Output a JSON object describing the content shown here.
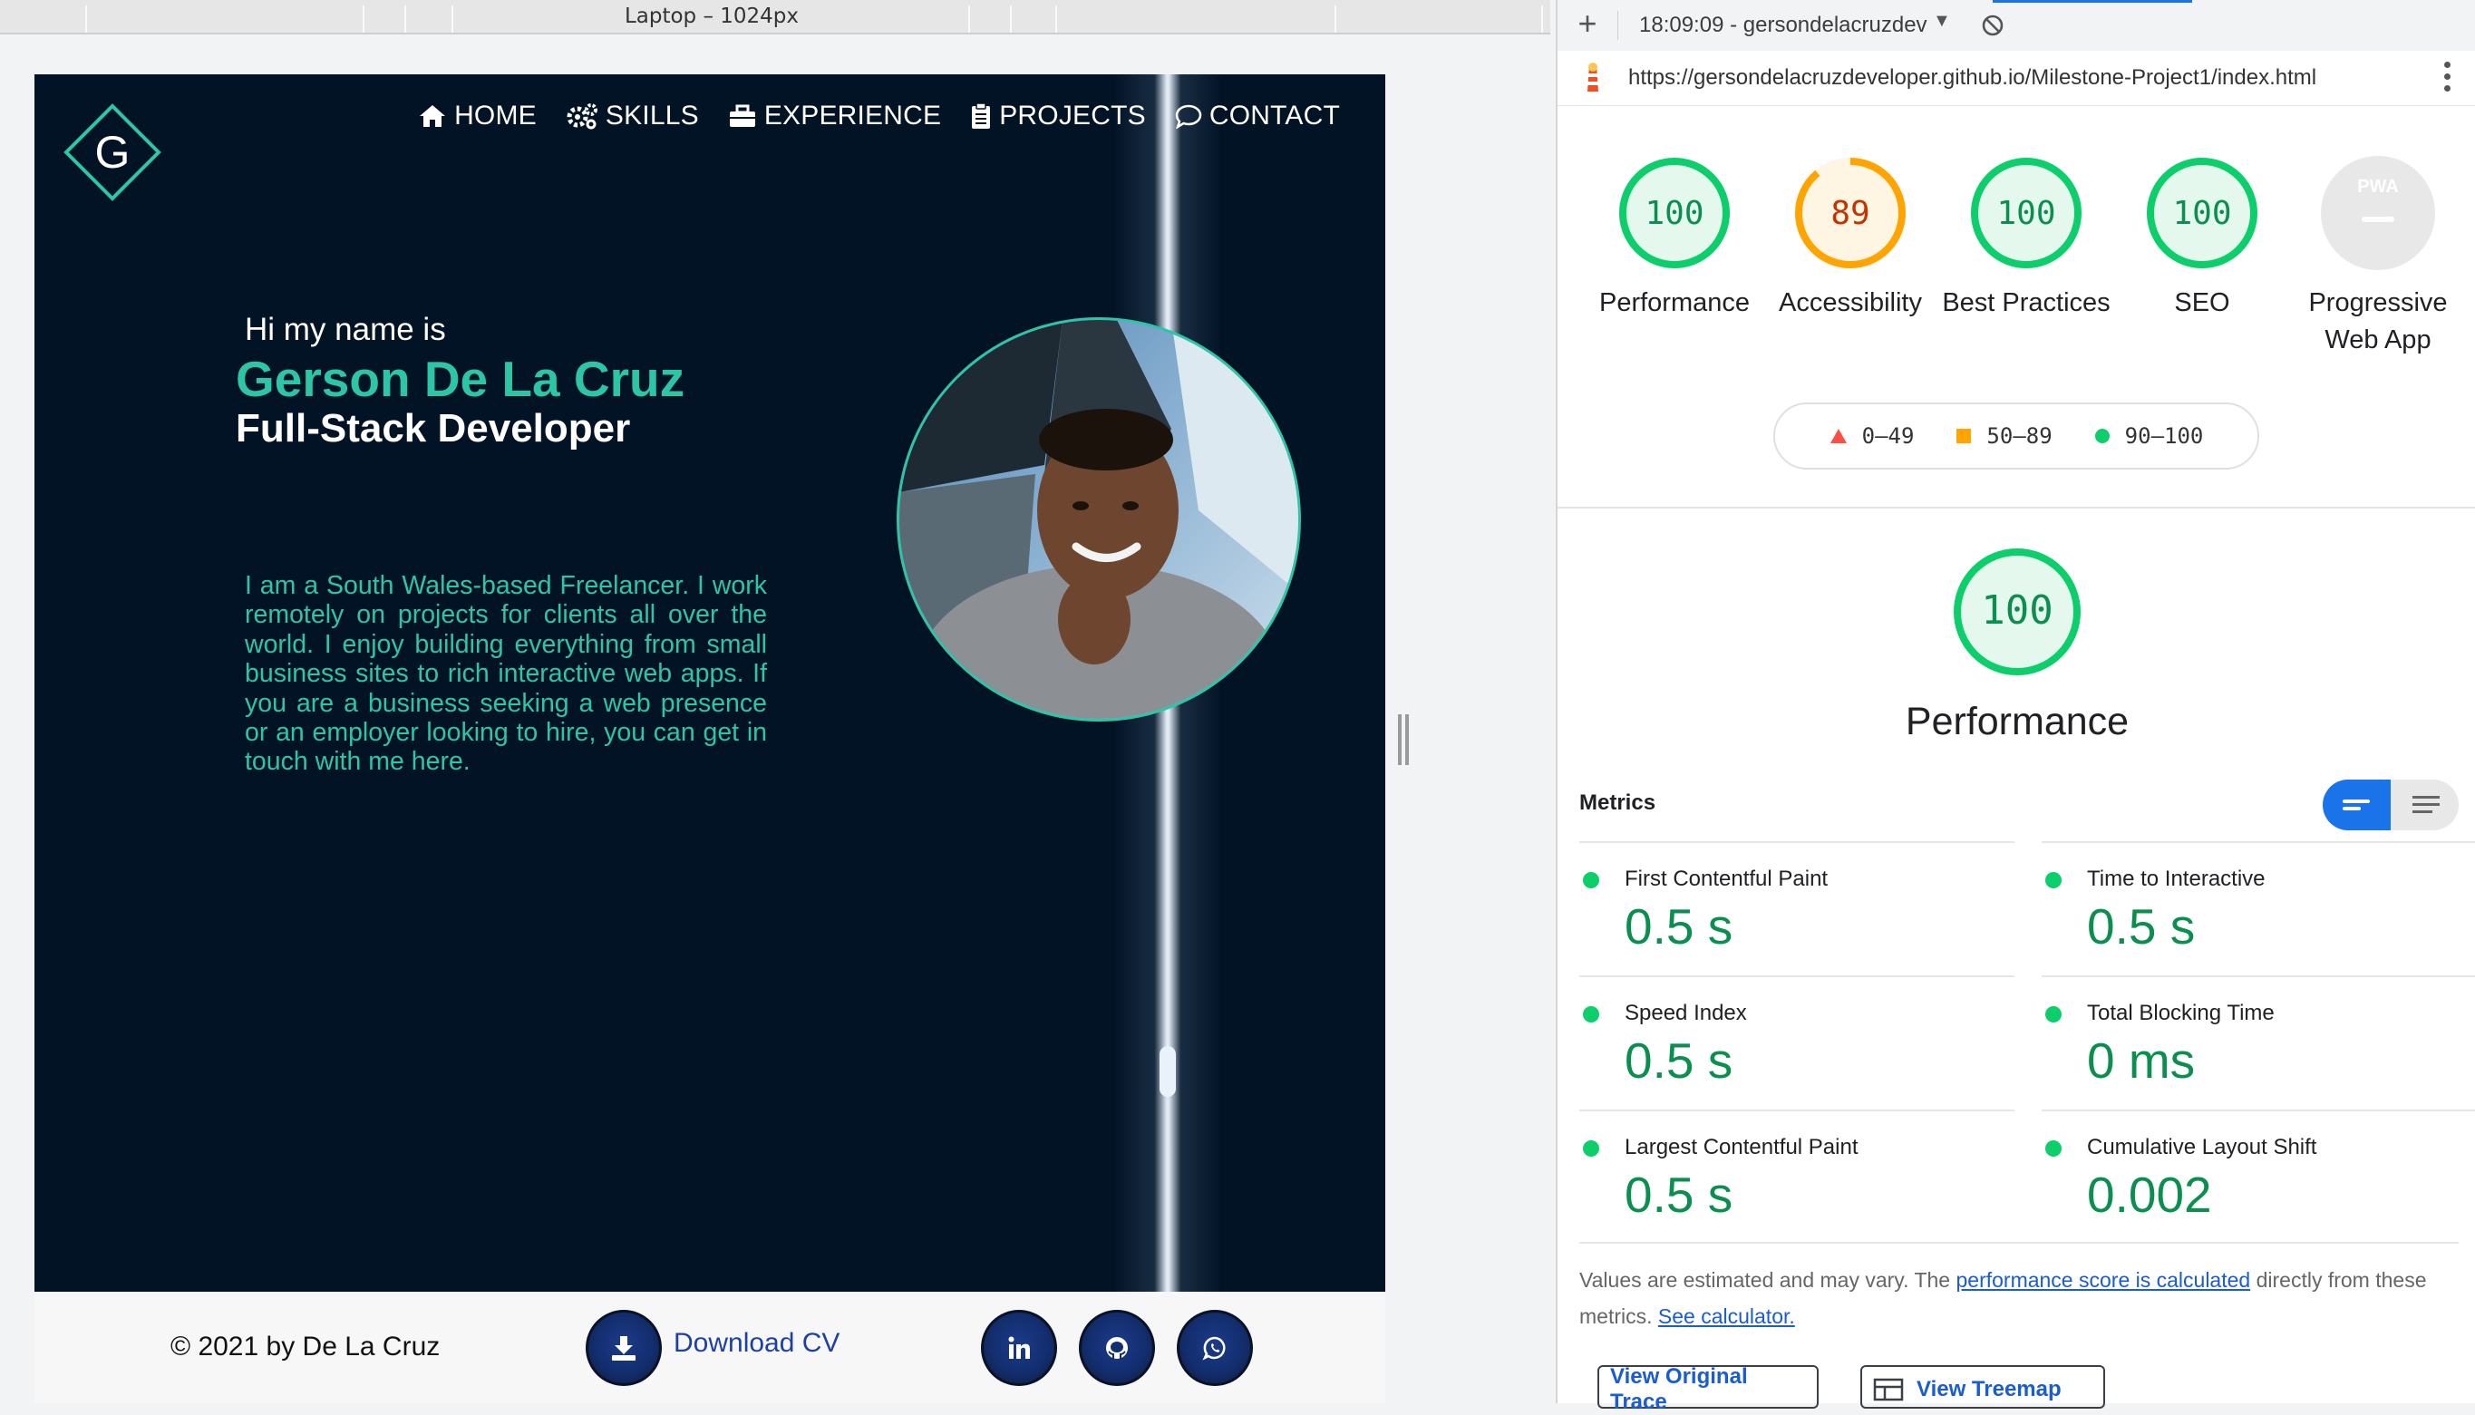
{
  "devtools_ruler": {
    "label": "Laptop – 1024px"
  },
  "site": {
    "logo_letter": "G",
    "nav": [
      {
        "label": "HOME",
        "icon": "home-icon"
      },
      {
        "label": "SKILLS",
        "icon": "gears-icon"
      },
      {
        "label": "EXPERIENCE",
        "icon": "toolbox-icon"
      },
      {
        "label": "PROJECTS",
        "icon": "clipboard-icon"
      },
      {
        "label": "CONTACT",
        "icon": "chat-icon"
      }
    ],
    "hero": {
      "greeting": "Hi my name is",
      "name": "Gerson De La Cruz",
      "role": "Full-Stack Developer",
      "bio": "I am a South Wales-based Freelancer. I work remotely on projects for clients all over the world. I enjoy building everything from small business sites to rich interactive web apps. If you are a business seeking a web presence or an employer looking to hire, you can get in touch with me here."
    },
    "footer": {
      "copyright": "© 2021 by De La Cruz",
      "download_cv": "Download CV",
      "social": [
        "linkedin-icon",
        "github-icon",
        "whatsapp-icon"
      ]
    },
    "colors": {
      "hero_bg": "#031326",
      "accent": "#2cc6a6"
    }
  },
  "lighthouse": {
    "session": "18:09:09 - gersondelacruzdev",
    "url": "https://gersondelacruzdeveloper.github.io/Milestone-Project1/index.html",
    "categories": [
      {
        "label": "Performance",
        "score": "100",
        "value": 100,
        "color": "#0cce6b"
      },
      {
        "label": "Accessibility",
        "score": "89",
        "value": 89,
        "color": "#ffa400"
      },
      {
        "label": "Best Practices",
        "score": "100",
        "value": 100,
        "color": "#0cce6b"
      },
      {
        "label": "SEO",
        "score": "100",
        "value": 100,
        "color": "#0cce6b"
      },
      {
        "label": "Progressive Web App",
        "score": "PWA",
        "value": null,
        "color": "#9e9e9e"
      }
    ],
    "legend": [
      {
        "range": "0–49",
        "color": "#ff4e42"
      },
      {
        "range": "50–89",
        "color": "#ffa400"
      },
      {
        "range": "90–100",
        "color": "#0cce6b"
      }
    ],
    "performance": {
      "score": "100",
      "title": "Performance"
    },
    "metrics_heading": "Metrics",
    "metrics": [
      {
        "label": "First Contentful Paint",
        "value": "0.5 s"
      },
      {
        "label": "Time to Interactive",
        "value": "0.5 s"
      },
      {
        "label": "Speed Index",
        "value": "0.5 s"
      },
      {
        "label": "Total Blocking Time",
        "value": "0 ms"
      },
      {
        "label": "Largest Contentful Paint",
        "value": "0.5 s"
      },
      {
        "label": "Cumulative Layout Shift",
        "value": "0.002"
      }
    ],
    "note": {
      "before": "Values are estimated and may vary. The ",
      "link1": "performance score is calculated",
      "middle": " directly from these metrics. ",
      "link2": "See calculator."
    },
    "buttons": {
      "view_trace": "View Original Trace",
      "view_treemap": "View Treemap"
    }
  }
}
